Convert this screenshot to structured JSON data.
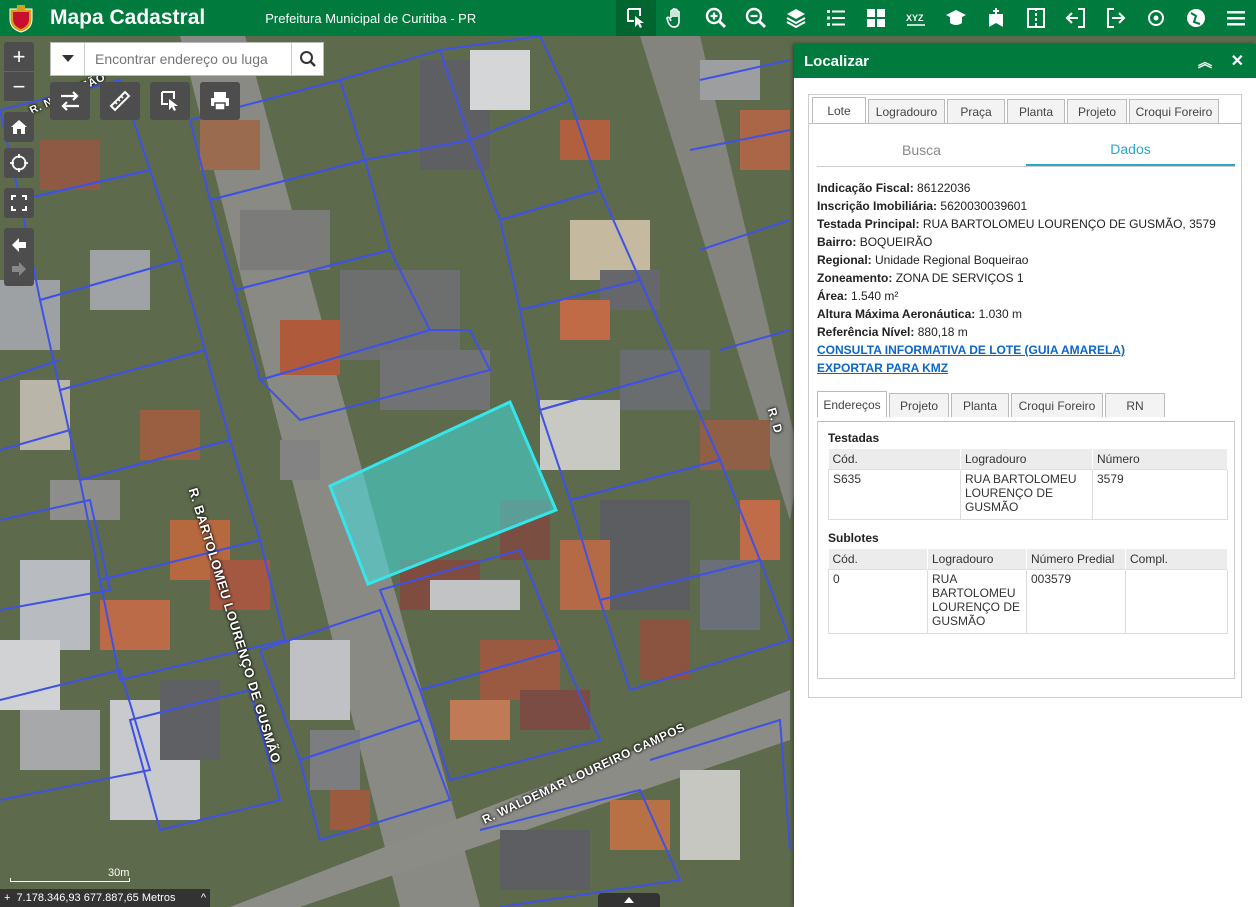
{
  "header": {
    "title": "Mapa Cadastral",
    "subtitle": "Prefeitura Municipal de Curitiba - PR",
    "tools": [
      "identify-icon",
      "pan-icon",
      "zoom-in-icon",
      "zoom-out-icon",
      "layers-icon",
      "legend-icon",
      "grid-icon",
      "xyz-icon",
      "education-icon",
      "bookmark-icon",
      "compare-icon",
      "import-icon",
      "export-icon",
      "locate-icon",
      "map-icon",
      "menu-icon"
    ]
  },
  "search": {
    "placeholder": "Encontrar endereço ou luga"
  },
  "map": {
    "streets": [
      "R. BARTOLOMEU LOURENÇO DE GUSMÃO",
      "R. WALDEMAR LOUREIRO CAMPOS",
      "R. NAPOLEÃO",
      "R. D"
    ],
    "scale_label": "30m",
    "coordinates": "7.178.346,93 677.887,65 Metros",
    "colors": {
      "lot_lines": "#3f52e6",
      "selected_fill": "#41e0e0",
      "selected_stroke": "#34e6ec"
    }
  },
  "panel": {
    "title": "Localizar",
    "tabs": [
      "Lote",
      "Logradouro",
      "Praça",
      "Planta",
      "Projeto",
      "Croqui Foreiro"
    ],
    "subtabs": [
      "Busca",
      "Dados"
    ],
    "fields": [
      {
        "label": "Indicação Fiscal:",
        "value": "86122036"
      },
      {
        "label": "Inscrição Imobiliária:",
        "value": "5620030039601"
      },
      {
        "label": "Testada Principal:",
        "value": "RUA BARTOLOMEU LOURENÇO DE GUSMÃO, 3579"
      },
      {
        "label": "Bairro:",
        "value": "BOQUEIRÃO"
      },
      {
        "label": "Regional:",
        "value": "Unidade Regional Boqueirao"
      },
      {
        "label": "Zoneamento:",
        "value": "ZONA DE SERVIÇOS 1"
      },
      {
        "label": "Área:",
        "value": "1.540 m²"
      },
      {
        "label": "Altura Máxima Aeronáutica:",
        "value": "1.030 m"
      },
      {
        "label": "Referência Nível:",
        "value": "880,18 m"
      }
    ],
    "links": [
      "CONSULTA INFORMATIVA DE LOTE (GUIA AMARELA)",
      "EXPORTAR PARA KMZ"
    ],
    "detail_tabs": [
      "Endereços",
      "Projeto",
      "Planta",
      "Croqui Foreiro",
      "RN"
    ],
    "testadas": {
      "title": "Testadas",
      "headers": [
        "Cód.",
        "Logradouro",
        "Número"
      ],
      "rows": [
        [
          "S635",
          "RUA BARTOLOMEU LOURENÇO DE GUSMÃO",
          "3579"
        ]
      ]
    },
    "sublotes": {
      "title": "Sublotes",
      "headers": [
        "Cód.",
        "Logradouro",
        "Número Predial",
        "Compl."
      ],
      "rows": [
        [
          "0",
          "RUA BARTOLOMEU LOURENÇO DE GUSMÃO",
          "003579",
          ""
        ]
      ]
    }
  }
}
